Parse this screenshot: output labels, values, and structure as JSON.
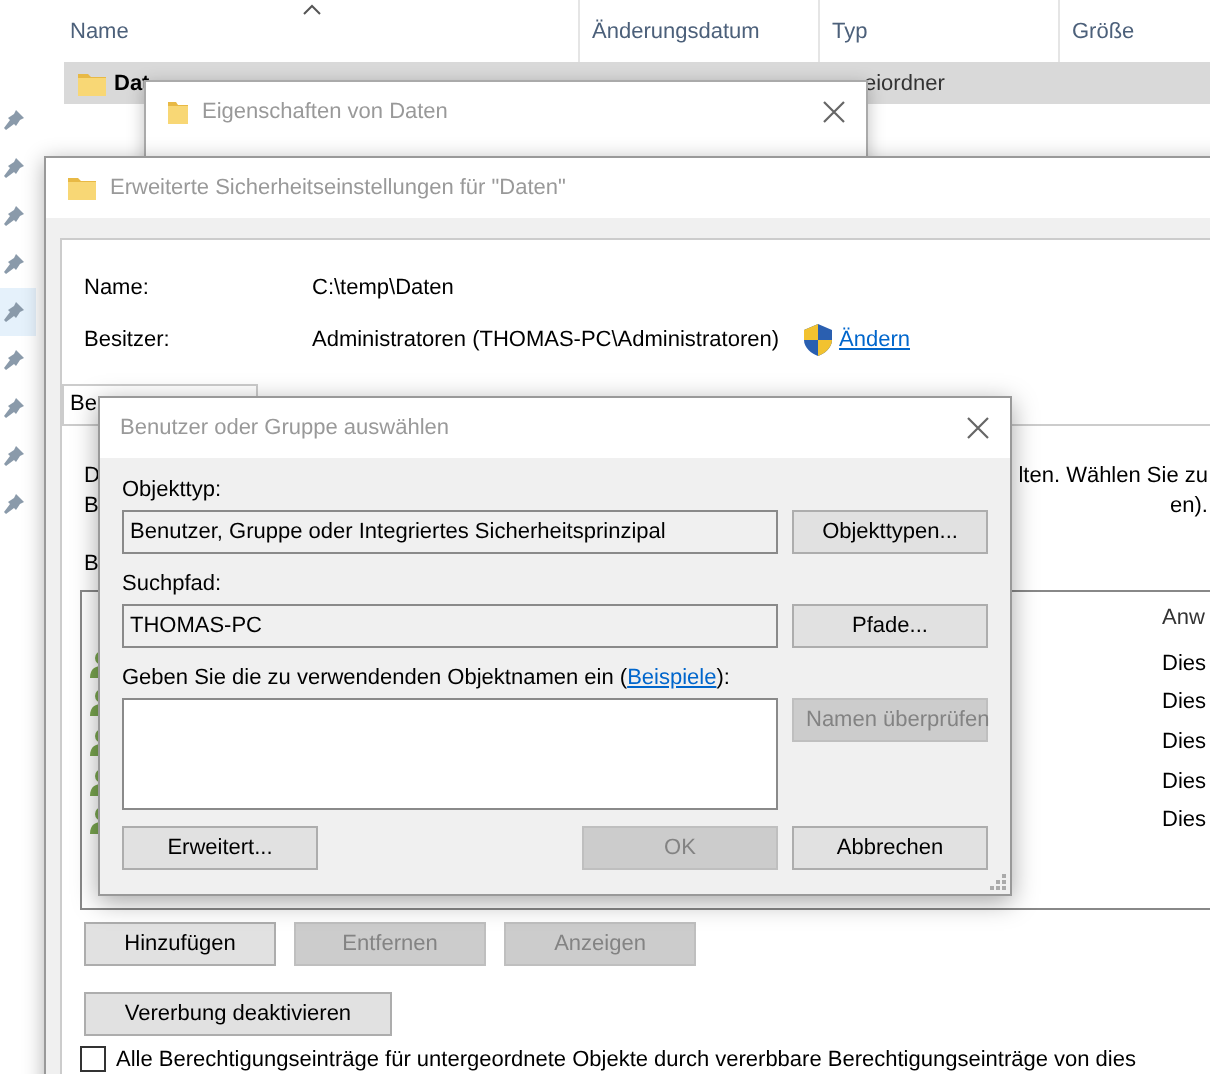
{
  "explorer": {
    "columns": [
      {
        "label": "Name",
        "sorted": true
      },
      {
        "label": "Änderungsdatum",
        "sorted": false
      },
      {
        "label": "Typ",
        "sorted": false
      },
      {
        "label": "Größe",
        "sorted": false
      }
    ],
    "rows": [
      {
        "name": "Dat",
        "type": "eiordner",
        "selected": true
      }
    ]
  },
  "properties_window": {
    "title": "Eigenschaften von Daten"
  },
  "advanced_window": {
    "title": "Erweiterte Sicherheitseinstellungen für \"Daten\"",
    "fields": [
      {
        "label": "Name:",
        "value": "C:\\temp\\Daten"
      },
      {
        "label": "Besitzer:",
        "value": "Administratoren (THOMAS-PC\\Administratoren)",
        "link": "Ändern"
      }
    ],
    "tabs": [
      {
        "label": "Be",
        "selected": true
      }
    ],
    "text_lines": [
      {
        "left": "D",
        "right": "lten. Wählen Sie zu"
      },
      {
        "left": "B",
        "right": "en)."
      }
    ],
    "list_label": "B",
    "list": {
      "column": "Anw",
      "rows": [
        "Dies",
        "Dies",
        "Dies",
        "Dies",
        "Dies"
      ]
    },
    "buttons": [
      {
        "label": "Hinzufügen",
        "disabled": false
      },
      {
        "label": "Entfernen",
        "disabled": true
      },
      {
        "label": "Anzeigen",
        "disabled": true
      }
    ],
    "inherit_button": {
      "label": "Vererbung deaktivieren",
      "disabled": false
    },
    "checkbox": {
      "label": "Alle Berechtigungseinträge für untergeordnete Objekte durch vererbbare Berechtigungseinträge von dies",
      "checked": false
    }
  },
  "select_dialog": {
    "title": "Benutzer oder Gruppe auswählen",
    "rows": [
      {
        "label": "Objekttyp:",
        "value": "Benutzer, Gruppe oder Integriertes Sicherheitsprinzipal",
        "button": {
          "label": "Objekttypen...",
          "disabled": false
        }
      },
      {
        "label": "Suchpfad:",
        "value": "THOMAS-PC",
        "button": {
          "label": "Pfade...",
          "disabled": false
        }
      }
    ],
    "names": {
      "label_before": "Geben Sie die zu verwendenden Objektnamen ein (",
      "link": "Beispiele",
      "label_after": "):",
      "button": {
        "label": "Namen überprüfen",
        "disabled": true
      }
    },
    "footer_buttons": [
      {
        "label": "Erweitert...",
        "disabled": false,
        "kind": "left"
      },
      {
        "label": "OK",
        "disabled": true,
        "kind": "right"
      },
      {
        "label": "Abbrechen",
        "disabled": false,
        "kind": "right"
      }
    ]
  }
}
